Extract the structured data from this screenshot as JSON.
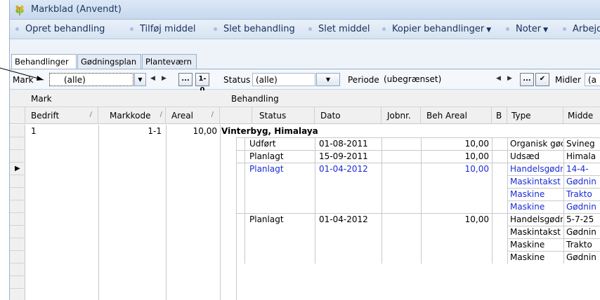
{
  "window": {
    "title": "Markblad (Anvendt)"
  },
  "menu": [
    {
      "label": "Opret behandling",
      "dropdown": false
    },
    {
      "label": "Tilføj middel",
      "dropdown": false
    },
    {
      "label": "Slet behandling",
      "dropdown": false
    },
    {
      "label": "Slet middel",
      "dropdown": false
    },
    {
      "label": "Kopier behandlinger",
      "dropdown": true
    },
    {
      "label": "Noter",
      "dropdown": true
    },
    {
      "label": "Arbejd",
      "dropdown": false
    }
  ],
  "tabs": [
    "Behandlinger",
    "Gødningsplan",
    "Planteværn"
  ],
  "filters": {
    "mark_label": "Mark",
    "mark_value": "(alle)",
    "status_label": "Status",
    "status_value": "(alle)",
    "periode_label": "Periode",
    "periode_value": "(ubegrænset)",
    "midler_label": "Midler",
    "midler_value": "(a",
    "ellipsis": "...",
    "range_icon": "1-0",
    "check": "✔"
  },
  "grid": {
    "band_mark": "Mark",
    "band_behandling": "Behandling",
    "columns": {
      "bedrift": "Bedrift",
      "markkode": "Markkode",
      "areal": "Areal",
      "status": "Status",
      "dato": "Dato",
      "jobnr": "Jobnr.",
      "beh_areal": "Beh Areal",
      "b": "B",
      "type": "Type",
      "midde": "Midde"
    },
    "sort_mark": "/",
    "mark_row": {
      "bedrift": "1",
      "markkode": "1-1",
      "areal": "10,00",
      "crop": "Vinterbyg, Himalaya"
    },
    "treatments": [
      {
        "status": "Udført",
        "dato": "01-08-2011",
        "beh_areal": "10,00",
        "current": false,
        "items": [
          {
            "type": "Organisk gødni",
            "middel": "Svineg"
          }
        ]
      },
      {
        "status": "Planlagt",
        "dato": "15-09-2011",
        "beh_areal": "10,00",
        "current": false,
        "items": [
          {
            "type": "Udsæd",
            "middel": "Himala"
          }
        ]
      },
      {
        "status": "Planlagt",
        "dato": "01-04-2012",
        "beh_areal": "10,00",
        "current": true,
        "items": [
          {
            "type": "Handelsgødnin",
            "middel": "14-4-"
          },
          {
            "type": "Maskintakst",
            "middel": "Gødnin"
          },
          {
            "type": "Maskine",
            "middel": "Trakto"
          },
          {
            "type": "Maskine",
            "middel": "Gødnin"
          }
        ]
      },
      {
        "status": "Planlagt",
        "dato": "01-04-2012",
        "beh_areal": "10,00",
        "current": false,
        "items": [
          {
            "type": "Handelsgødnin",
            "middel": "5-7-25"
          },
          {
            "type": "Maskintakst",
            "middel": "Gødnin"
          },
          {
            "type": "Maskine",
            "middel": "Trakto"
          },
          {
            "type": "Maskine",
            "middel": "Gødnin"
          }
        ]
      }
    ]
  },
  "colors": {
    "current_row": "#1a2cd6",
    "title_text": "#1e395b"
  }
}
